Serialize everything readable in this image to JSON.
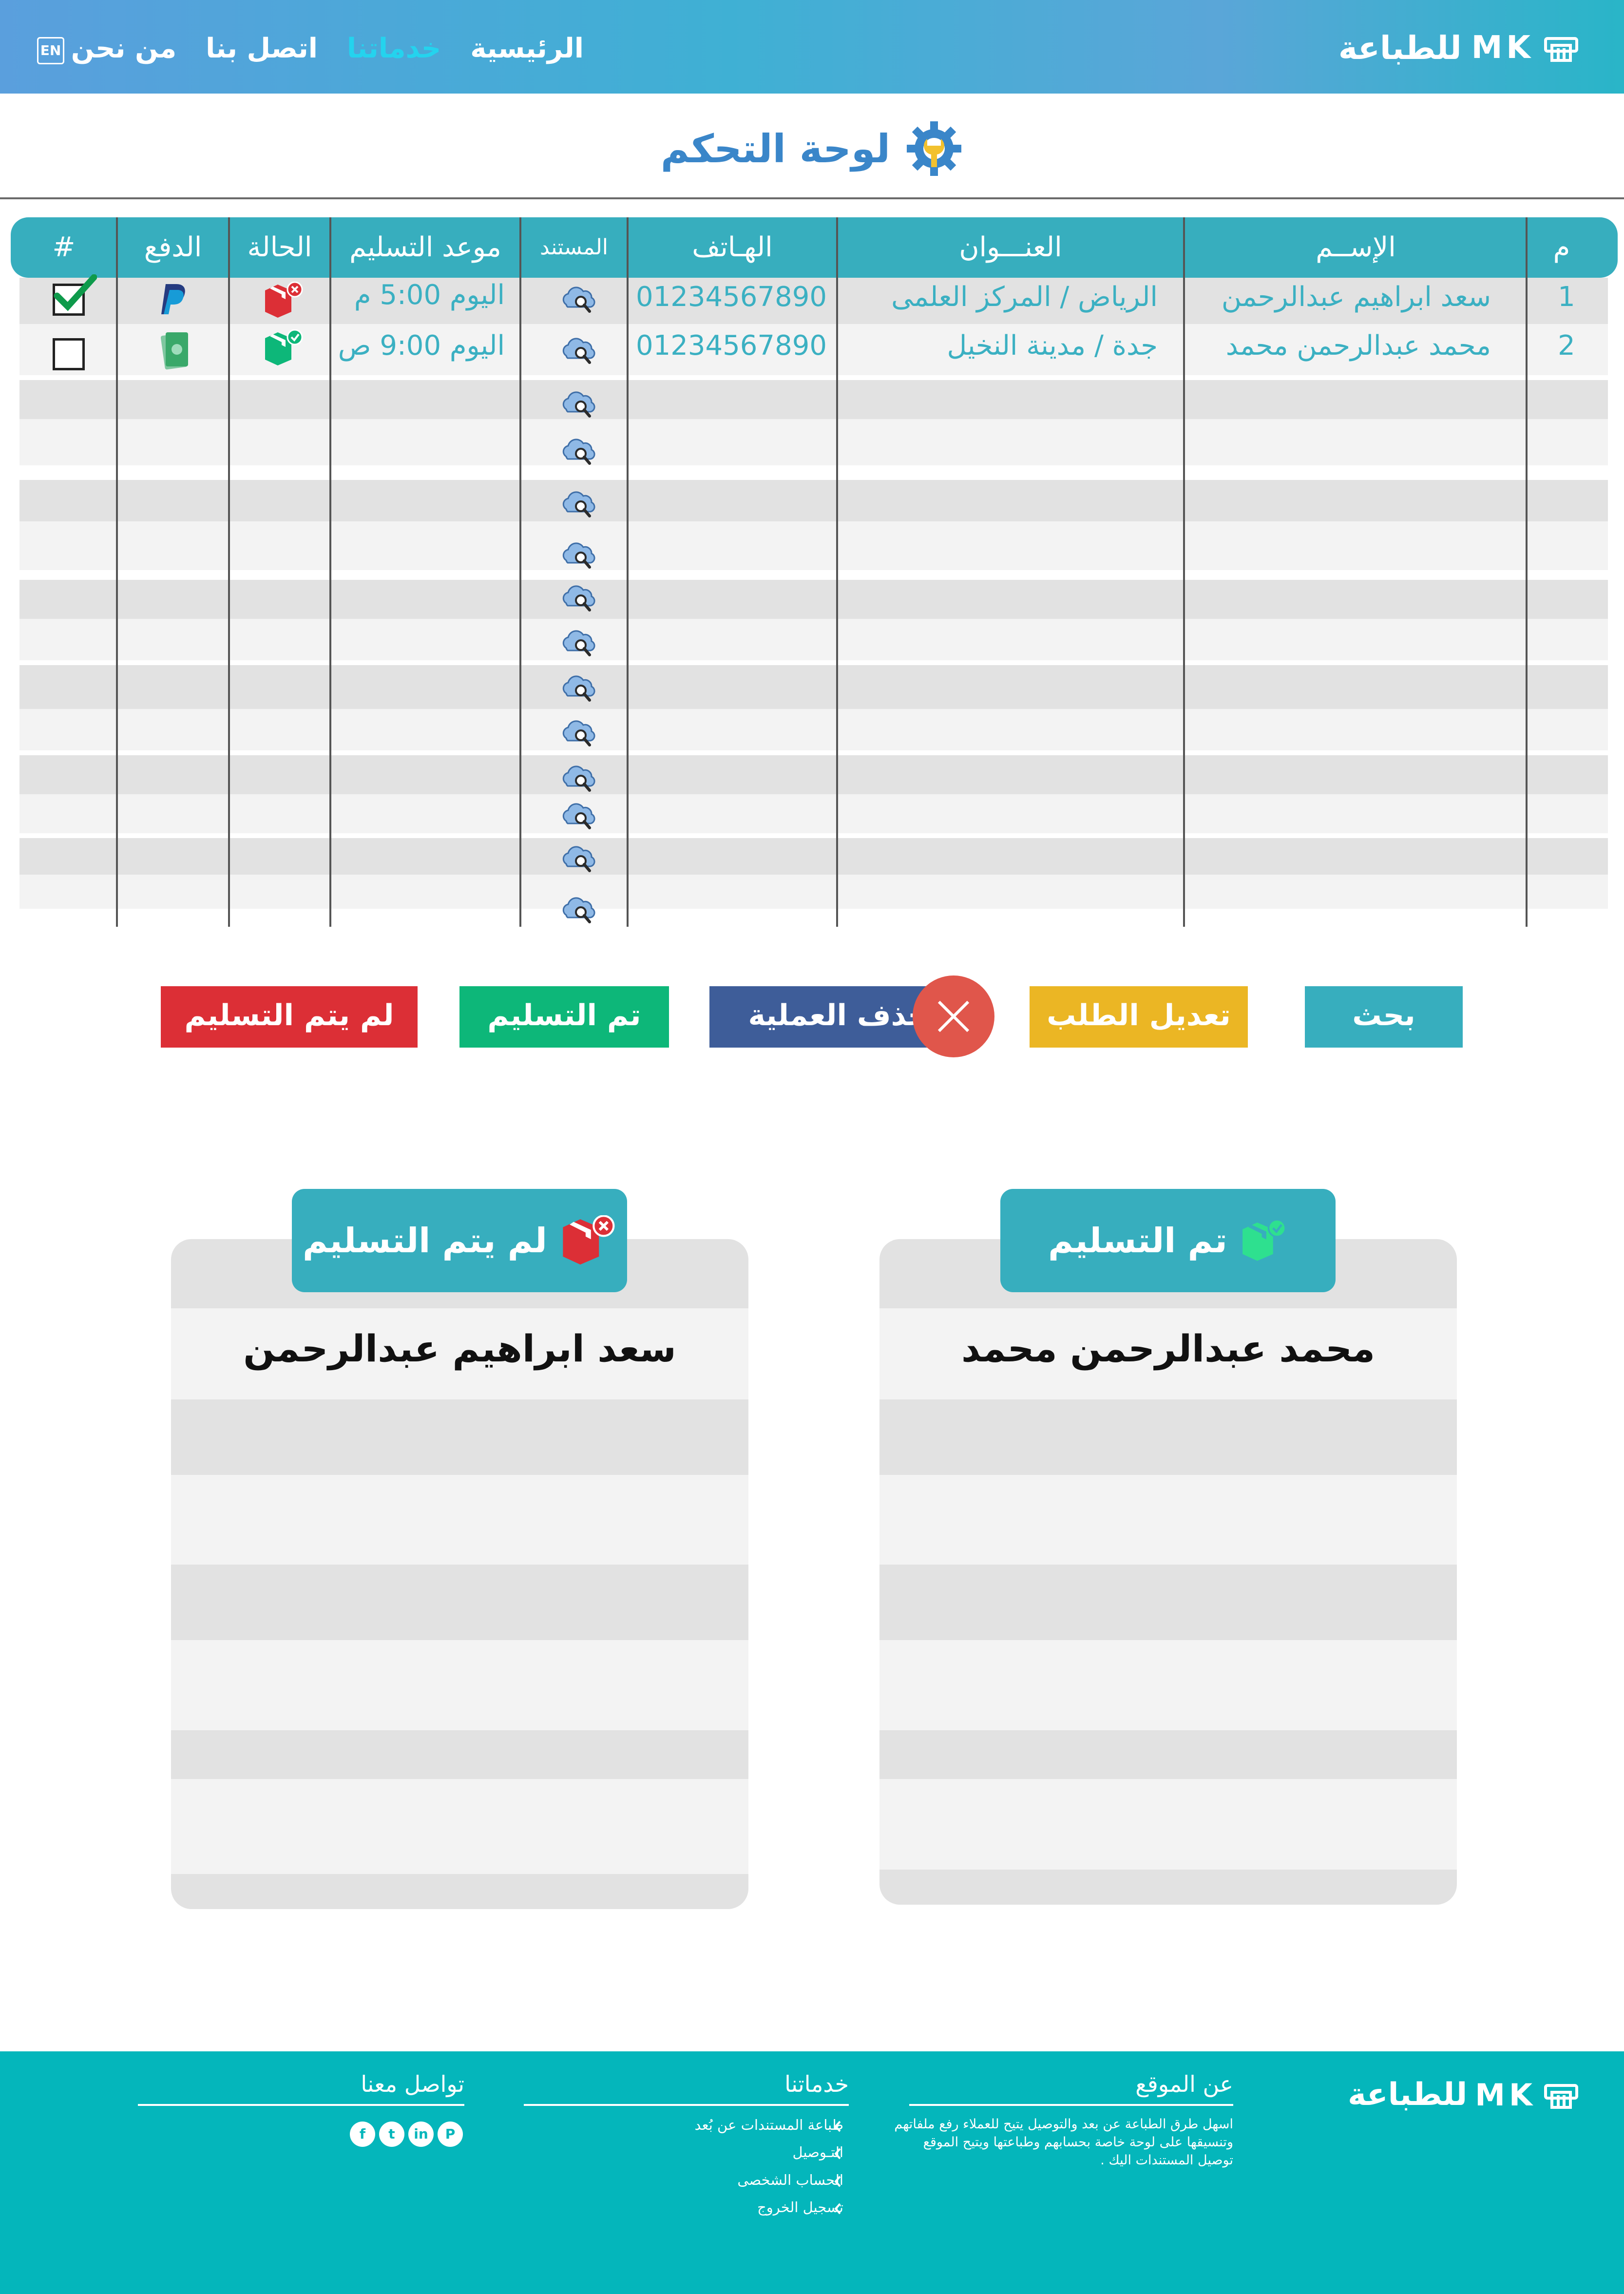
{
  "nav": {
    "logo_text": "للطباعة",
    "logo_mk": "MK",
    "links": [
      "الرئيسية",
      "خدماتنا",
      "اتصل بنا",
      "من نحن"
    ],
    "active_link": "خدماتنا",
    "lang": "EN"
  },
  "page": {
    "title": "لوحة التحكم"
  },
  "table": {
    "headers": {
      "index": "م",
      "name": "الإســم",
      "address": "العنـــوان",
      "phone": "الهـاتف",
      "document": "المستند",
      "delivery_time": "موعد التسليم",
      "status": "الحالة",
      "payment": "الدفع",
      "select": "#"
    },
    "rows": [
      {
        "index": "1",
        "name": "سعد ابراهيم عبدالرحمن",
        "address": "الرياض / المركز العلمى",
        "phone": "01234567890",
        "delivery_time": "اليوم 5:00 م",
        "status": "not-delivered",
        "payment": "paypal",
        "selected": true
      },
      {
        "index": "2",
        "name": "محمد عبدالرحمن محمد",
        "address": "جدة / مدينة النخيل",
        "phone": "01234567890",
        "delivery_time": "اليوم 9:00 ص",
        "status": "delivered",
        "payment": "cash",
        "selected": false
      }
    ],
    "empty_rows": 12
  },
  "buttons": {
    "search": "بحث",
    "edit": "تعديل الطلب",
    "delete": "حذف العملية",
    "delivered": "تم التسليم",
    "not_delivered": "لم يتم التسليم"
  },
  "panels": {
    "delivered": {
      "title": "تم التسليم",
      "names": [
        "محمد عبدالرحمن محمد"
      ]
    },
    "not_delivered": {
      "title": "لم يتم التسليم",
      "names": [
        "سعد ابراهيم عبدالرحمن"
      ]
    }
  },
  "footer": {
    "logo_text": "للطباعة",
    "logo_mk": "MK",
    "about": {
      "title": "عن الموقع",
      "text": "اسهل طرق الطباعة عن بعد والتوصيل يتيح للعملاء رفع ملفاتهم وتنسيقها على لوحة خاصة بحسابهم وطباعتها ويتيح الموقع توصيل المستندات اليك ."
    },
    "services": {
      "title": "خدماتنا",
      "items": [
        "طباعة المستندات عن بُعد",
        "التـوصيل",
        "الحساب الشخصى",
        "تسجيل الخروج"
      ]
    },
    "contact": {
      "title": "تواصل معنا",
      "social": [
        "facebook-icon",
        "twitter-icon",
        "linkedin-icon",
        "pinterest-icon"
      ]
    }
  },
  "colors": {
    "accent": "#37aebe",
    "title_blue": "#3a86c9",
    "edit": "#ebb624",
    "delete": "#3e5d99",
    "delivered": "#0db779",
    "not_delivered": "#dc2f36",
    "footer": "#04b6bb"
  }
}
